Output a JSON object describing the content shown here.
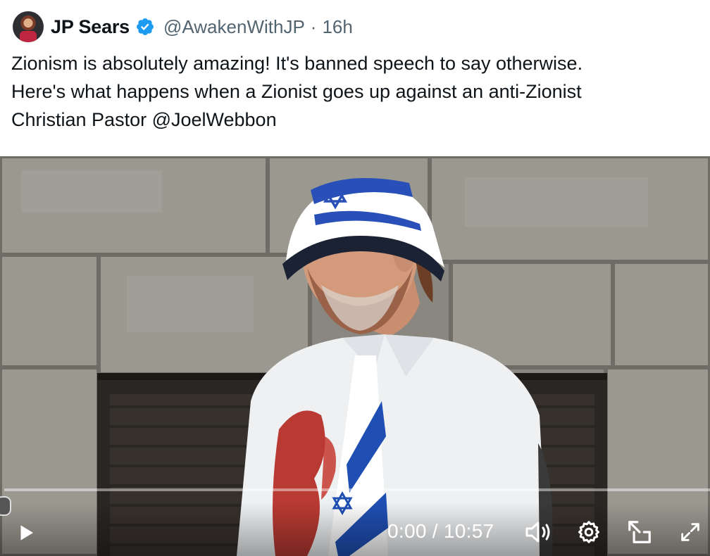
{
  "author": {
    "display_name": "JP Sears",
    "handle": "@AwakenWithJP",
    "separator": "·",
    "timestamp": "16h",
    "verified": true,
    "verified_color": "#1d9bf0"
  },
  "tweet": {
    "text_line1": "Zionism is absolutely amazing! It's banned speech to say otherwise.",
    "text_line2": "Here's what happens when a Zionist goes up against an anti-Zionist",
    "text_line3_prefix": "Christian Pastor ",
    "mention": "@JoelWebbon"
  },
  "video": {
    "time_display": "0:00 / 10:57",
    "progress_fraction": 0,
    "icons": {
      "play": "play-icon",
      "volume": "volume-icon",
      "settings": "gear-icon",
      "popout": "picture-in-picture-icon",
      "fullscreen": "fullscreen-icon"
    }
  }
}
